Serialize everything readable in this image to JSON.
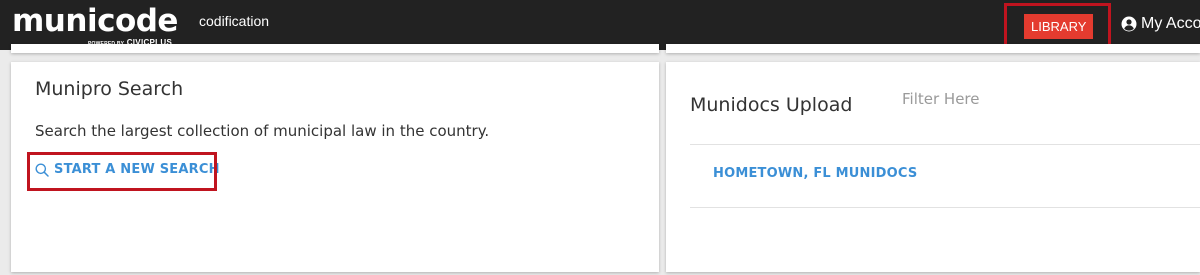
{
  "header": {
    "logo_text": "municode",
    "powered_prefix": "POWERED BY",
    "powered_brand": "CIVICPLUS",
    "section_label": "codification",
    "library_button": "LIBRARY",
    "account_label": "My Acco"
  },
  "munipro": {
    "title": "Munipro Search",
    "description": "Search the largest collection of municipal law in the country.",
    "search_link": "START A NEW SEARCH"
  },
  "munidocs": {
    "title": "Munidocs Upload",
    "filter_placeholder": "Filter Here",
    "items": [
      {
        "label": "HOMETOWN, FL MUNIDOCS"
      }
    ]
  },
  "colors": {
    "topbar": "#222222",
    "library_button": "#e43b2f",
    "highlight_box": "#c0141f",
    "link": "#3b8fd6"
  }
}
